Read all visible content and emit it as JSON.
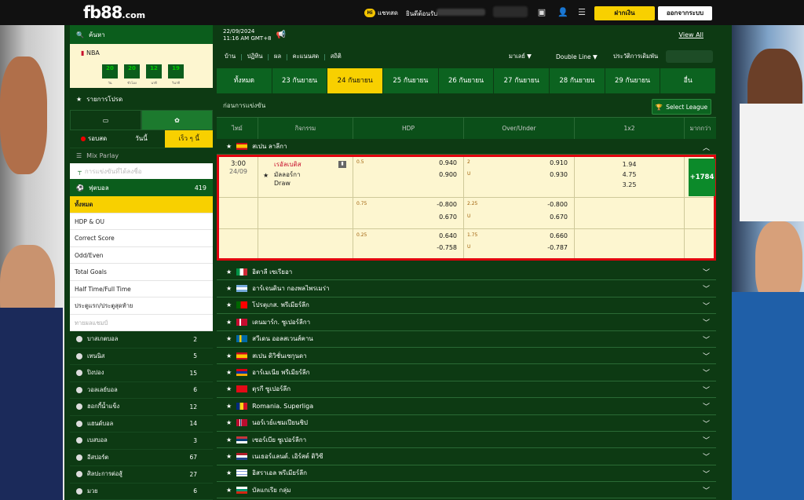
{
  "header": {
    "logo": "fb88",
    "logo_suffix": ".com",
    "chat_label": "แชทสด",
    "welcome": "ยินดีต้อนรับ",
    "deposit_button": "ฝากเงิน",
    "wallet_button": "ออกจากระบบ"
  },
  "sidebar": {
    "search_label": "ค้นหา",
    "nba_label": "NBA",
    "countdown": [
      {
        "value": "20",
        "unit": "วัน"
      },
      {
        "value": "20",
        "unit": "ชั่วโมง"
      },
      {
        "value": "12",
        "unit": "นาที"
      },
      {
        "value": "19",
        "unit": "วินาที"
      }
    ],
    "my_program": "รายการโปรด",
    "tabs": [
      {
        "label": "รอบสด",
        "active": false
      },
      {
        "label": "วันนี้",
        "active": false
      },
      {
        "label": "เร็ว ๆ นี้",
        "active": true
      }
    ],
    "mix_parlay": "Mix Parlay",
    "hidden_row": "การแข่งขันที่ได้ลงชื่อ",
    "football": {
      "label": "ฟุตบอล",
      "count": "419"
    },
    "menu": [
      {
        "label": "ทั้งหมด",
        "active": true
      },
      {
        "label": "HDP & OU",
        "active": false
      },
      {
        "label": "Correct Score",
        "active": false
      },
      {
        "label": "Odd/Even",
        "active": false
      },
      {
        "label": "Total Goals",
        "active": false
      },
      {
        "label": "Half Time/Full Time",
        "active": false
      },
      {
        "label": "ประตูแรก/ประตูสุดท้าย",
        "active": false
      },
      {
        "label": "ทายผลแชมป์",
        "active": false,
        "dim": true
      }
    ],
    "sports": [
      {
        "label": "บาสเกตบอล",
        "count": "2"
      },
      {
        "label": "เทนนิส",
        "count": "5"
      },
      {
        "label": "ปิงปอง",
        "count": "15"
      },
      {
        "label": "วอลเลย์บอล",
        "count": "6"
      },
      {
        "label": "ฮอกกี้น้ำแข็ง",
        "count": "12"
      },
      {
        "label": "แฮนด์บอล",
        "count": "14"
      },
      {
        "label": "เบสบอล",
        "count": "3"
      },
      {
        "label": "อีสปอร์ต",
        "count": "67"
      },
      {
        "label": "ศิลปะการต่อสู้",
        "count": "27"
      },
      {
        "label": "มวย",
        "count": "6"
      }
    ]
  },
  "main": {
    "date": "22/09/2024",
    "time": "11:16 AM GMT+8",
    "view_all": "View All",
    "nav": [
      "บ้าน",
      "ปฏิทิน",
      "ผล",
      "คะแนนสด",
      "สถิติ"
    ],
    "market_select": "มาเลย์",
    "line_select": "Double Line",
    "bet_history": "ประวัติการเดิมพัน",
    "date_tabs": [
      {
        "label": "ทั้งหมด",
        "active": false
      },
      {
        "label": "23 กันยายน",
        "active": false
      },
      {
        "label": "24 กันยายน",
        "active": true
      },
      {
        "label": "25 กันยายน",
        "active": false
      },
      {
        "label": "26 กันยายน",
        "active": false
      },
      {
        "label": "27 กันยายน",
        "active": false
      },
      {
        "label": "28 กันยายน",
        "active": false
      },
      {
        "label": "29 กันยายน",
        "active": false
      },
      {
        "label": "อื่น",
        "active": false
      }
    ],
    "section_title": "ก่อนการแข่งขัน",
    "select_league": "Select League",
    "columns": {
      "time": "ไทม์",
      "event": "กิจกรรม",
      "hdp": "HDP",
      "ou": "Over/Under",
      "x12": "1x2",
      "more": "มากกว่า"
    },
    "featured_league": "สเปน ลาลีกา",
    "match": {
      "time": "3:00",
      "date": "24/09",
      "home": "เรอัลเบติส",
      "away": "มัลลอร์กา",
      "draw": "Draw",
      "more": "+1784",
      "rows": [
        {
          "hdp": "0.5",
          "hdp_home": "0.940",
          "hdp_away": "0.900",
          "ou": "2",
          "ou_u": "U",
          "ou_over": "0.910",
          "ou_under": "0.930",
          "x1": "1.94",
          "x2": "4.75",
          "xd": "3.25"
        },
        {
          "hdp": "0.75",
          "hdp_home": "-0.800",
          "hdp_away": "0.670",
          "ou": "2.25",
          "ou_u": "U",
          "ou_over": "-0.800",
          "ou_under": "0.670"
        },
        {
          "hdp": "0.25",
          "hdp_home": "0.640",
          "hdp_away": "-0.758",
          "ou": "1.75",
          "ou_u": "U",
          "ou_over": "0.660",
          "ou_under": "-0.787"
        }
      ]
    },
    "leagues": [
      {
        "name": "อิตาลี เซเรียอา",
        "flag": "it"
      },
      {
        "name": "อาร์เจนตินา กองพลไพรเมร่า",
        "flag": "ar"
      },
      {
        "name": "โปรตุเกส. พรีเมียร์ลีก",
        "flag": "pt"
      },
      {
        "name": "เดนมาร์ก. ซูเปอร์ลีกา",
        "flag": "dk"
      },
      {
        "name": "สวีเดน ออลสเวนส์คาน",
        "flag": "se"
      },
      {
        "name": "สเปน ดิวิชั่นเซกุนดา",
        "flag": "es"
      },
      {
        "name": "อาร์เมเนีย พรีเมียร์ลีก",
        "flag": "am"
      },
      {
        "name": "ตุรกี ซูเปอร์ลีก",
        "flag": "tr"
      },
      {
        "name": "Romania. Superliga",
        "flag": "ro"
      },
      {
        "name": "นอร์เวย์แชมเปียนชิป",
        "flag": "no"
      },
      {
        "name": "เซอร์เบีย ซูเปอร์ลีกา",
        "flag": "rs"
      },
      {
        "name": "เนเธอร์แลนด์. เอิร์สต์ ดิวิซี",
        "flag": "nl"
      },
      {
        "name": "อิสราเอล พรีเมียร์ลีก",
        "flag": "il"
      },
      {
        "name": "บัลแกเรีย กลุ่ม",
        "flag": "bg"
      }
    ]
  }
}
